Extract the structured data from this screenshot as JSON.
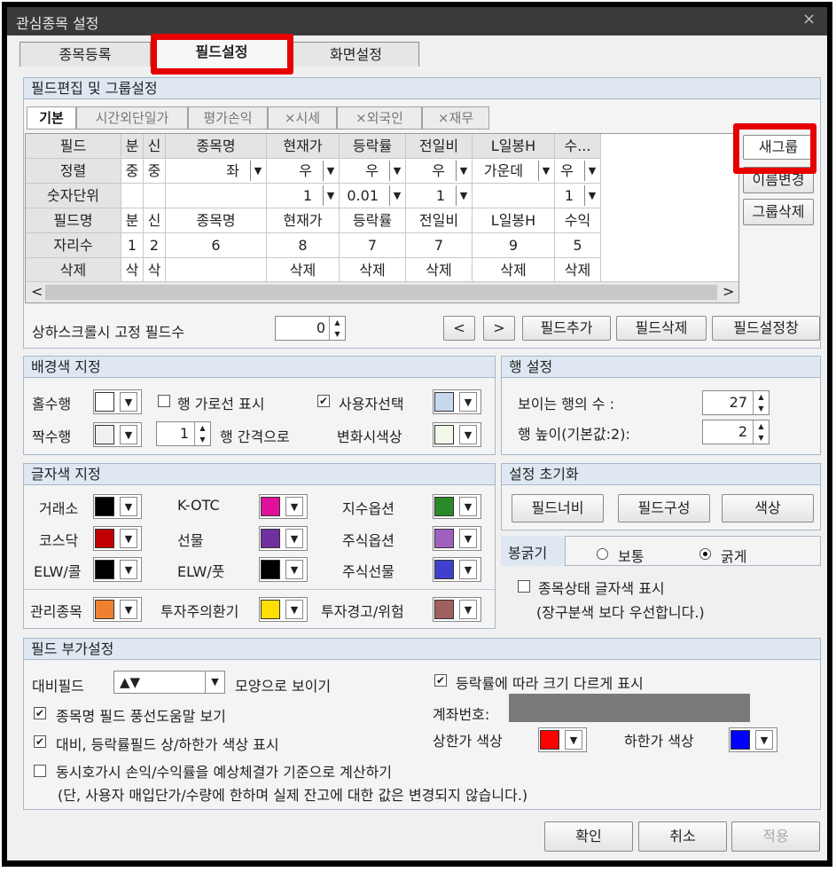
{
  "window": {
    "title": "관심종목 설정",
    "close": "×"
  },
  "tabs": [
    "종목등록",
    "필드설정",
    "화면설정"
  ],
  "field_edit": {
    "header": "필드편집 및 그룹설정",
    "subtabs": [
      "기본",
      "시간외단일가",
      "평가손익",
      "×시세",
      "×외국인",
      "×재무"
    ],
    "grid": {
      "cols": [
        "필드",
        "분",
        "신",
        "종목명",
        "현재가",
        "등락률",
        "전일비",
        "L일봉H",
        "수..."
      ],
      "rows": [
        [
          "정렬",
          "중",
          "중",
          "좌",
          "우",
          "우",
          "우",
          "가운데",
          "우"
        ],
        [
          "숫자단위",
          "",
          "",
          "",
          "1",
          "0.01",
          "1",
          "",
          "1"
        ],
        [
          "필드명",
          "분",
          "신",
          "종목명",
          "현재가",
          "등락률",
          "전일비",
          "L일봉H",
          "수익"
        ],
        [
          "자리수",
          "1",
          "2",
          "6",
          "8",
          "7",
          "7",
          "9",
          "5"
        ],
        [
          "삭제",
          "삭",
          "삭",
          "",
          "삭제",
          "삭제",
          "삭제",
          "삭제",
          "삭제"
        ]
      ]
    },
    "side_buttons": [
      "새그룹",
      "이름변경",
      "그룹삭제"
    ],
    "fixed_label": "상하스크롤시 고정 필드수",
    "fixed_value": "0",
    "nav_prev": "<",
    "nav_next": ">",
    "buttons": [
      "필드추가",
      "필드삭제",
      "필드설정창"
    ]
  },
  "bg": {
    "header": "배경색 지정",
    "odd": "홀수행",
    "even": "짝수행",
    "row_line": "행 가로선 표시",
    "row_gap_val": "1",
    "row_gap": "행 간격으로",
    "user_sel": "사용자선택",
    "change_color": "변화시색상",
    "colors": {
      "odd": "#ffffff",
      "even": "#f0f0f0",
      "user": "#c8d8ec",
      "change": "#f0f8e8"
    }
  },
  "row": {
    "header": "행 설정",
    "count_label": "보이는 행의 수 :",
    "count": "27",
    "height_label": "행 높이(기본값:2):",
    "height": "2"
  },
  "font": {
    "header": "글자색 지정",
    "items": [
      {
        "label": "거래소",
        "color": "#000000"
      },
      {
        "label": "K-OTC",
        "color": "#e0109a"
      },
      {
        "label": "지수옵션",
        "color": "#2a8a2a"
      },
      {
        "label": "코스닥",
        "color": "#c00000"
      },
      {
        "label": "선물",
        "color": "#7030a0"
      },
      {
        "label": "주식옵션",
        "color": "#a060c0"
      },
      {
        "label": "ELW/콜",
        "color": "#000000"
      },
      {
        "label": "ELW/풋",
        "color": "#000000"
      },
      {
        "label": "주식선물",
        "color": "#4040d0"
      }
    ],
    "extra": [
      {
        "label": "관리종목",
        "color": "#f08030"
      },
      {
        "label": "투자주의환기",
        "color": "#ffe000"
      },
      {
        "label": "투자경고/위험",
        "color": "#a06060"
      }
    ]
  },
  "reset": {
    "header": "설정 초기화",
    "buttons": [
      "필드너비",
      "필드구성",
      "색상"
    ]
  },
  "bold": {
    "label": "봉굵기",
    "opt1": "보통",
    "opt2": "굵게",
    "status": "종목상태 글자색 표시",
    "note": "(장구분색 보다 우선합니다.)"
  },
  "extra": {
    "header": "필드 부가설정",
    "daebi": "대비필드",
    "daebi_val": "▲▼",
    "shape": "모양으로 보이기",
    "size": "등락률에 따라 크기 다르게 표시",
    "balloon": "종목명 필드 풍선도움말 보기",
    "account": "계좌번호:",
    "updown": "대비, 등락률필드 상/하한가 색상 표시",
    "upper": "상한가 색상",
    "upper_color": "#ff0000",
    "lower": "하한가 색상",
    "lower_color": "#0000ff",
    "calc": "동시호가시 손익/수익률을 예상체결가 기준으로 계산하기",
    "calc_note": "(단, 사용자 매입단가/수량에 한하며 실제 잔고에 대한 값은 변경되지 않습니다.)"
  },
  "footer": {
    "ok": "확인",
    "cancel": "취소",
    "apply": "적용"
  }
}
